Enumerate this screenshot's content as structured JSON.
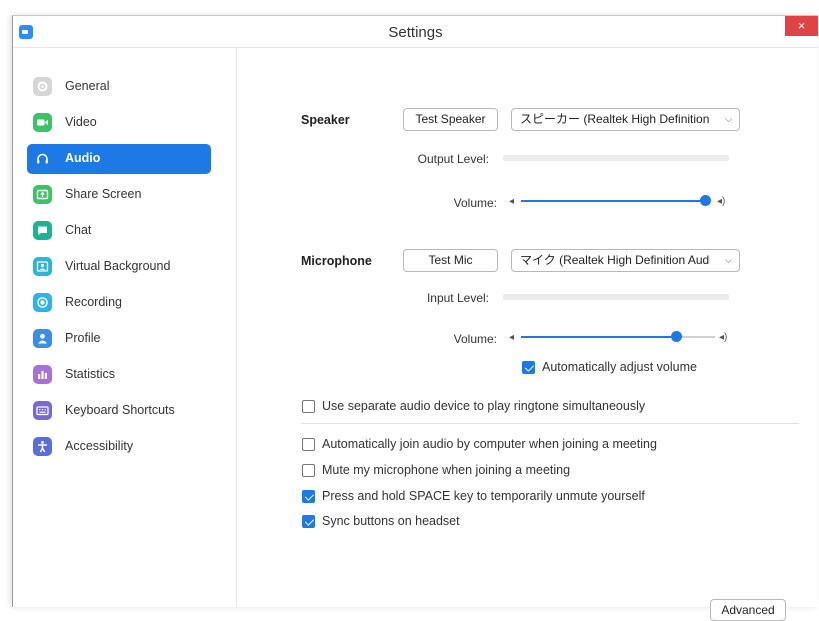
{
  "window": {
    "title": "Settings",
    "close_label": "×"
  },
  "sidebar": {
    "items": [
      {
        "label": "General",
        "color": "#d6d6d6"
      },
      {
        "label": "Video",
        "color": "#3cc36a"
      },
      {
        "label": "Audio",
        "color": "#1d79e6"
      },
      {
        "label": "Share Screen",
        "color": "#3cc36a"
      },
      {
        "label": "Chat",
        "color": "#1ab394"
      },
      {
        "label": "Virtual Background",
        "color": "#29b6d8"
      },
      {
        "label": "Recording",
        "color": "#2db3e8"
      },
      {
        "label": "Profile",
        "color": "#3a8ee6"
      },
      {
        "label": "Statistics",
        "color": "#a970d9"
      },
      {
        "label": "Keyboard Shortcuts",
        "color": "#7b68d6"
      },
      {
        "label": "Accessibility",
        "color": "#5b6dd8"
      }
    ],
    "active_index": 2
  },
  "speaker": {
    "heading": "Speaker",
    "test_button": "Test Speaker",
    "device": "スピーカー (Realtek High Definition ...",
    "output_level_label": "Output Level:",
    "volume_label": "Volume:",
    "volume_percent": 100
  },
  "microphone": {
    "heading": "Microphone",
    "test_button": "Test Mic",
    "device": "マイク (Realtek High Definition Audi...",
    "input_level_label": "Input Level:",
    "volume_label": "Volume:",
    "volume_percent": 80,
    "auto_adjust_label": "Automatically adjust volume",
    "auto_adjust_checked": true
  },
  "options": [
    {
      "label": "Use separate audio device to play ringtone simultaneously",
      "checked": false
    },
    {
      "label": "Automatically join audio by computer when joining a meeting",
      "checked": false
    },
    {
      "label": "Mute my microphone when joining a meeting",
      "checked": false
    },
    {
      "label": "Press and hold SPACE key to temporarily unmute yourself",
      "checked": true
    },
    {
      "label": "Sync buttons on headset",
      "checked": true
    }
  ],
  "advanced_button": "Advanced"
}
